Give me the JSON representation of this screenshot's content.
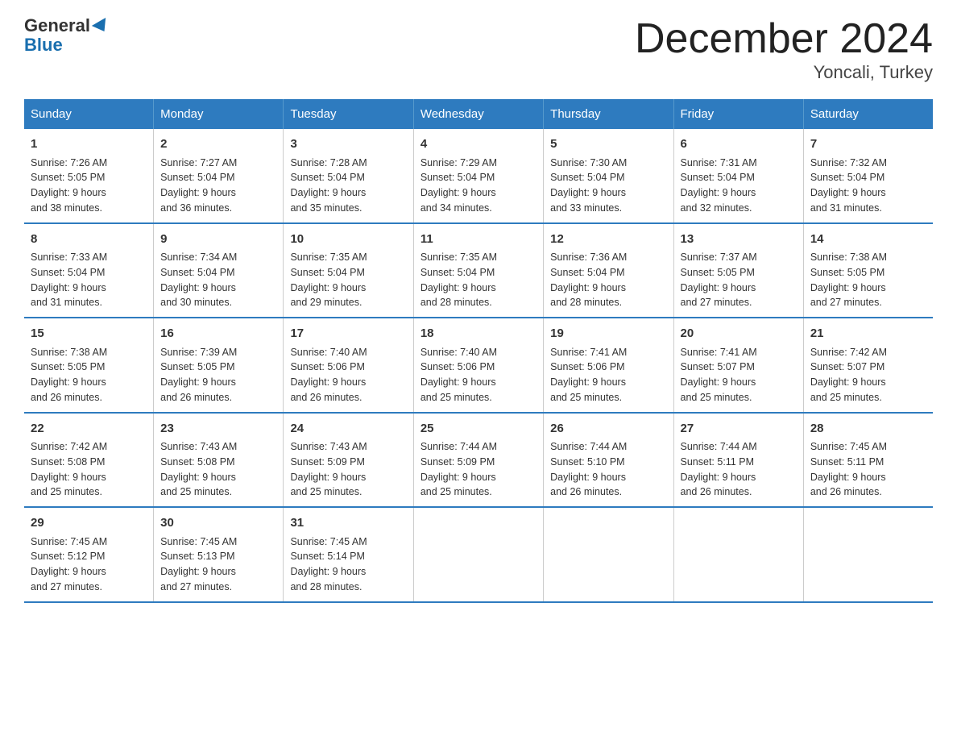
{
  "header": {
    "logo_general": "General",
    "logo_blue": "Blue",
    "title": "December 2024",
    "subtitle": "Yoncali, Turkey"
  },
  "columns": [
    "Sunday",
    "Monday",
    "Tuesday",
    "Wednesday",
    "Thursday",
    "Friday",
    "Saturday"
  ],
  "weeks": [
    [
      {
        "day": "1",
        "info": "Sunrise: 7:26 AM\nSunset: 5:05 PM\nDaylight: 9 hours\nand 38 minutes."
      },
      {
        "day": "2",
        "info": "Sunrise: 7:27 AM\nSunset: 5:04 PM\nDaylight: 9 hours\nand 36 minutes."
      },
      {
        "day": "3",
        "info": "Sunrise: 7:28 AM\nSunset: 5:04 PM\nDaylight: 9 hours\nand 35 minutes."
      },
      {
        "day": "4",
        "info": "Sunrise: 7:29 AM\nSunset: 5:04 PM\nDaylight: 9 hours\nand 34 minutes."
      },
      {
        "day": "5",
        "info": "Sunrise: 7:30 AM\nSunset: 5:04 PM\nDaylight: 9 hours\nand 33 minutes."
      },
      {
        "day": "6",
        "info": "Sunrise: 7:31 AM\nSunset: 5:04 PM\nDaylight: 9 hours\nand 32 minutes."
      },
      {
        "day": "7",
        "info": "Sunrise: 7:32 AM\nSunset: 5:04 PM\nDaylight: 9 hours\nand 31 minutes."
      }
    ],
    [
      {
        "day": "8",
        "info": "Sunrise: 7:33 AM\nSunset: 5:04 PM\nDaylight: 9 hours\nand 31 minutes."
      },
      {
        "day": "9",
        "info": "Sunrise: 7:34 AM\nSunset: 5:04 PM\nDaylight: 9 hours\nand 30 minutes."
      },
      {
        "day": "10",
        "info": "Sunrise: 7:35 AM\nSunset: 5:04 PM\nDaylight: 9 hours\nand 29 minutes."
      },
      {
        "day": "11",
        "info": "Sunrise: 7:35 AM\nSunset: 5:04 PM\nDaylight: 9 hours\nand 28 minutes."
      },
      {
        "day": "12",
        "info": "Sunrise: 7:36 AM\nSunset: 5:04 PM\nDaylight: 9 hours\nand 28 minutes."
      },
      {
        "day": "13",
        "info": "Sunrise: 7:37 AM\nSunset: 5:05 PM\nDaylight: 9 hours\nand 27 minutes."
      },
      {
        "day": "14",
        "info": "Sunrise: 7:38 AM\nSunset: 5:05 PM\nDaylight: 9 hours\nand 27 minutes."
      }
    ],
    [
      {
        "day": "15",
        "info": "Sunrise: 7:38 AM\nSunset: 5:05 PM\nDaylight: 9 hours\nand 26 minutes."
      },
      {
        "day": "16",
        "info": "Sunrise: 7:39 AM\nSunset: 5:05 PM\nDaylight: 9 hours\nand 26 minutes."
      },
      {
        "day": "17",
        "info": "Sunrise: 7:40 AM\nSunset: 5:06 PM\nDaylight: 9 hours\nand 26 minutes."
      },
      {
        "day": "18",
        "info": "Sunrise: 7:40 AM\nSunset: 5:06 PM\nDaylight: 9 hours\nand 25 minutes."
      },
      {
        "day": "19",
        "info": "Sunrise: 7:41 AM\nSunset: 5:06 PM\nDaylight: 9 hours\nand 25 minutes."
      },
      {
        "day": "20",
        "info": "Sunrise: 7:41 AM\nSunset: 5:07 PM\nDaylight: 9 hours\nand 25 minutes."
      },
      {
        "day": "21",
        "info": "Sunrise: 7:42 AM\nSunset: 5:07 PM\nDaylight: 9 hours\nand 25 minutes."
      }
    ],
    [
      {
        "day": "22",
        "info": "Sunrise: 7:42 AM\nSunset: 5:08 PM\nDaylight: 9 hours\nand 25 minutes."
      },
      {
        "day": "23",
        "info": "Sunrise: 7:43 AM\nSunset: 5:08 PM\nDaylight: 9 hours\nand 25 minutes."
      },
      {
        "day": "24",
        "info": "Sunrise: 7:43 AM\nSunset: 5:09 PM\nDaylight: 9 hours\nand 25 minutes."
      },
      {
        "day": "25",
        "info": "Sunrise: 7:44 AM\nSunset: 5:09 PM\nDaylight: 9 hours\nand 25 minutes."
      },
      {
        "day": "26",
        "info": "Sunrise: 7:44 AM\nSunset: 5:10 PM\nDaylight: 9 hours\nand 26 minutes."
      },
      {
        "day": "27",
        "info": "Sunrise: 7:44 AM\nSunset: 5:11 PM\nDaylight: 9 hours\nand 26 minutes."
      },
      {
        "day": "28",
        "info": "Sunrise: 7:45 AM\nSunset: 5:11 PM\nDaylight: 9 hours\nand 26 minutes."
      }
    ],
    [
      {
        "day": "29",
        "info": "Sunrise: 7:45 AM\nSunset: 5:12 PM\nDaylight: 9 hours\nand 27 minutes."
      },
      {
        "day": "30",
        "info": "Sunrise: 7:45 AM\nSunset: 5:13 PM\nDaylight: 9 hours\nand 27 minutes."
      },
      {
        "day": "31",
        "info": "Sunrise: 7:45 AM\nSunset: 5:14 PM\nDaylight: 9 hours\nand 28 minutes."
      },
      {
        "day": "",
        "info": ""
      },
      {
        "day": "",
        "info": ""
      },
      {
        "day": "",
        "info": ""
      },
      {
        "day": "",
        "info": ""
      }
    ]
  ]
}
